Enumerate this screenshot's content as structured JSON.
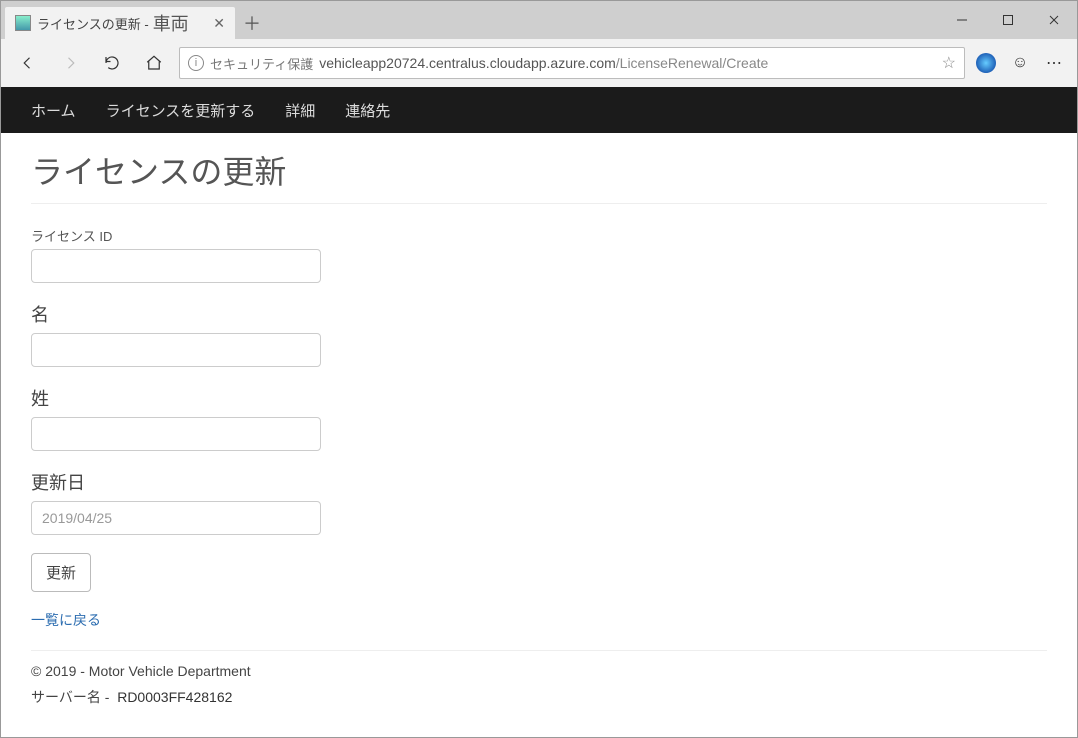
{
  "browser": {
    "tab": {
      "title_left": "ライセンスの更新 -",
      "title_right": "車両"
    },
    "security_label": "セキュリティ保護",
    "url_host": "vehicleapp20724.centralus.cloudapp.azure.com",
    "url_path": "/LicenseRenewal/Create"
  },
  "nav": {
    "home": "ホーム",
    "renew": "ライセンスを更新する",
    "details": "詳細",
    "contact": "連絡先"
  },
  "page": {
    "title": "ライセンスの更新",
    "fields": {
      "license_id": {
        "label": "ライセンス ID",
        "value": ""
      },
      "first_name": {
        "label": "名",
        "value": ""
      },
      "last_name": {
        "label": "姓",
        "value": ""
      },
      "renew_date": {
        "label": "更新日",
        "value": "2019/04/25"
      }
    },
    "submit_label": "更新",
    "back_link_label": "一覧に戻る"
  },
  "footer": {
    "copyright": "© 2019 - Motor Vehicle Department",
    "server_label": "サーバー名 -",
    "server_name": "RD0003FF428162"
  }
}
